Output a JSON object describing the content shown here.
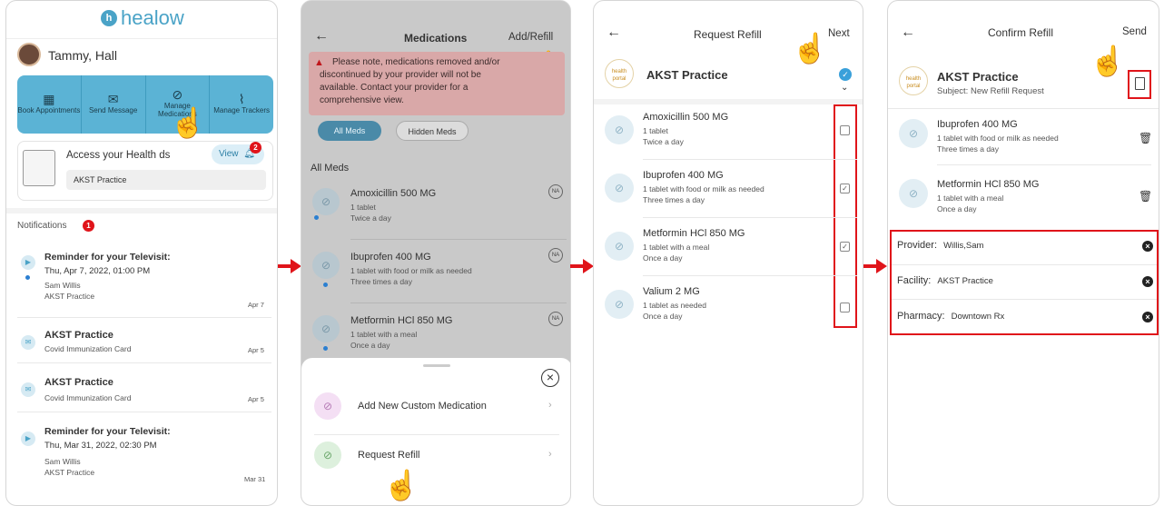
{
  "screen1": {
    "logo_text": "healow",
    "user_name": "Tammy, Hall",
    "tiles": [
      {
        "label": "Book Appointments",
        "icon": "calendar-icon"
      },
      {
        "label": "Send Message",
        "icon": "envelope-icon"
      },
      {
        "label": "Manage Medications",
        "icon": "pill-icon"
      },
      {
        "label": "Manage Trackers",
        "icon": "pulse-icon"
      }
    ],
    "records_title": "Access your Health   ds",
    "view_label": "View",
    "view_badge": "2",
    "practice": "AKST Practice",
    "notifications_label": "Notifications",
    "notifications_count": "1",
    "notifications": [
      {
        "title": "Reminder for your Televisit:",
        "line2": "Thu, Apr 7, 2022, 01:00 PM",
        "line3": "Sam Willis",
        "line4": "AKST Practice",
        "date": "Apr 7"
      },
      {
        "title": "AKST Practice",
        "line2": "Covid Immunization Card",
        "date": "Apr 5"
      },
      {
        "title": "AKST Practice",
        "line2": "Covid Immunization Card",
        "date": "Apr 5"
      },
      {
        "title": "Reminder for your Televisit:",
        "line2": "Thu, Mar 31, 2022, 02:30 PM",
        "line3": "Sam Willis",
        "line4": "AKST Practice",
        "date": "Mar 31"
      }
    ]
  },
  "screen2": {
    "back": "←",
    "title": "Medications",
    "action": "Add/Refill",
    "notice": [
      "Please note, medications removed and/or",
      "discontinued by your provider will not be",
      "available. Contact your provider for a",
      "comprehensive view."
    ],
    "tab_all": "All Meds",
    "tab_hidden": "Hidden Meds",
    "section": "All Meds",
    "meds": [
      {
        "name": "Amoxicillin 500 MG",
        "dose": "1 tablet",
        "freq": "Twice a day",
        "tag": "NA"
      },
      {
        "name": "Ibuprofen 400 MG",
        "dose": "1 tablet with food or milk as needed",
        "freq": "Three times a day",
        "tag": "NA"
      },
      {
        "name": "Metformin HCl 850 MG",
        "dose": "1 tablet with a meal",
        "freq": "Once a day",
        "tag": "NA"
      }
    ],
    "sheet_close": "×",
    "sheet_items": [
      "Add New Custom Medication",
      "Request Refill"
    ]
  },
  "screen3": {
    "back": "←",
    "title": "Request Refill",
    "action": "Next",
    "practice": "AKST Practice",
    "logo_text": "health portal",
    "meds": [
      {
        "name": "Amoxicillin 500 MG",
        "dose": "1 tablet",
        "freq": "Twice a day",
        "checked": false
      },
      {
        "name": "Ibuprofen 400 MG",
        "dose": "1 tablet with food or milk as needed",
        "freq": "Three times a day",
        "checked": true
      },
      {
        "name": "Metformin HCl 850 MG",
        "dose": "1 tablet with a meal",
        "freq": "Once a day",
        "checked": true
      },
      {
        "name": "Valium 2 MG",
        "dose": "1 tablet as needed",
        "freq": "Once a day",
        "checked": false
      }
    ]
  },
  "screen4": {
    "back": "←",
    "title": "Confirm Refill",
    "action": "Send",
    "practice": "AKST Practice",
    "subject": "Subject: New Refill Request",
    "logo_text": "health portal",
    "meds": [
      {
        "name": "Ibuprofen 400 MG",
        "dose": "1 tablet with food or milk as needed",
        "freq": "Three times a day"
      },
      {
        "name": "Metformin HCl 850 MG",
        "dose": "1 tablet with a meal",
        "freq": "Once a day"
      }
    ],
    "fields": [
      {
        "label": "Provider:",
        "value": "Willis,Sam"
      },
      {
        "label": "Facility:",
        "value": "AKST Practice"
      },
      {
        "label": "Pharmacy:",
        "value": "Downtown Rx"
      }
    ]
  }
}
